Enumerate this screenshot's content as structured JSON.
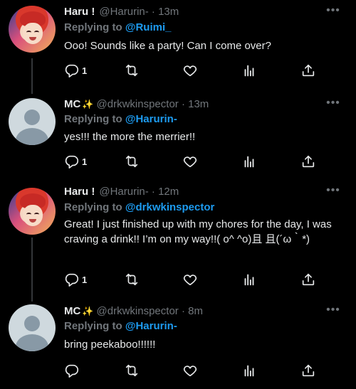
{
  "tweets": [
    {
      "name": "Haru !",
      "badge": "",
      "handle": "@Harurin-",
      "dot": "·",
      "time": "13m",
      "replying_label": "Replying to",
      "replying_to": "@Ruimi_",
      "text": "Ooo! Sounds like a party! Can I come over?",
      "reply_count": "1",
      "avatar": "anime-red-hair"
    },
    {
      "name": "MC",
      "badge": "✨",
      "handle": "@drkwkinspector",
      "dot": "·",
      "time": "13m",
      "replying_label": "Replying to",
      "replying_to": "@Harurin-",
      "text": "yes!!! the more the merrier!!",
      "reply_count": "1",
      "avatar": "default-profile"
    },
    {
      "name": "Haru !",
      "badge": "",
      "handle": "@Harurin-",
      "dot": "·",
      "time": "12m",
      "replying_label": "Replying to",
      "replying_to": "@drkwkinspector",
      "text": "Great! I just finished up with my chores for the day, I was craving a drink!! I’m on my way!!( o^ ^o)且 且(´ω｀*)",
      "reply_count": "1",
      "avatar": "anime-red-hair"
    },
    {
      "name": "MC",
      "badge": "✨",
      "handle": "@drkwkinspector",
      "dot": "·",
      "time": "8m",
      "replying_label": "Replying to",
      "replying_to": "@Harurin-",
      "text": "bring peekaboo!!!!!!",
      "reply_count": "",
      "avatar": "default-profile"
    }
  ],
  "icons": {
    "reply": "reply-icon",
    "retweet": "retweet-icon",
    "like": "heart-icon",
    "analytics": "analytics-icon",
    "share": "share-icon",
    "more": "more-options-icon"
  },
  "colors": {
    "background": "#000000",
    "text": "#e7e9ea",
    "muted": "#71767b",
    "accent": "#1d9bf0"
  }
}
